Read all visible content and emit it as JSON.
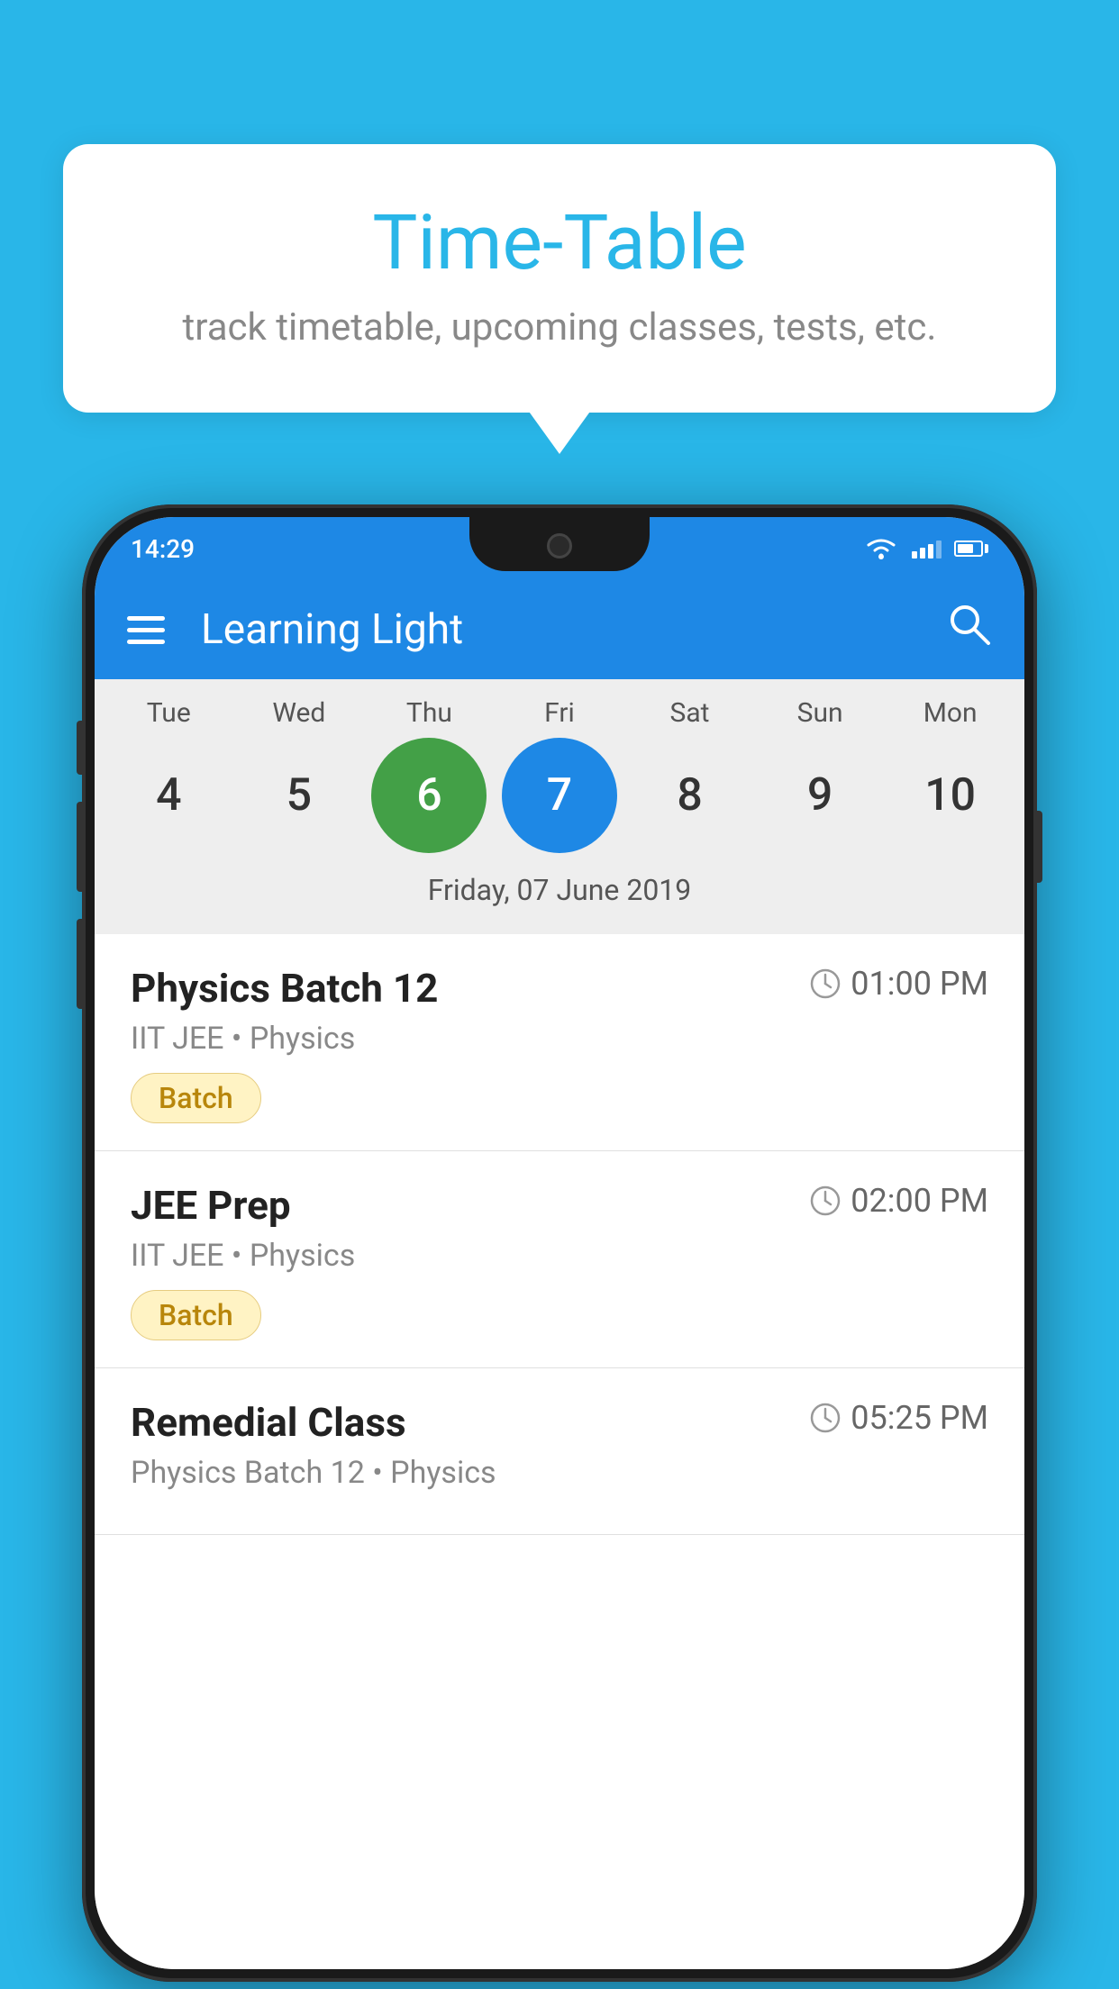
{
  "background_color": "#29b6e8",
  "tooltip": {
    "title": "Time-Table",
    "subtitle": "track timetable, upcoming classes, tests, etc."
  },
  "app": {
    "name": "Learning Light",
    "status_time": "14:29"
  },
  "calendar": {
    "days": [
      {
        "label": "Tue",
        "num": "4"
      },
      {
        "label": "Wed",
        "num": "5"
      },
      {
        "label": "Thu",
        "num": "6",
        "state": "today"
      },
      {
        "label": "Fri",
        "num": "7",
        "state": "selected"
      },
      {
        "label": "Sat",
        "num": "8"
      },
      {
        "label": "Sun",
        "num": "9"
      },
      {
        "label": "Mon",
        "num": "10"
      }
    ],
    "selected_date": "Friday, 07 June 2019"
  },
  "schedule": [
    {
      "name": "Physics Batch 12",
      "time": "01:00 PM",
      "meta": "IIT JEE • Physics",
      "tag": "Batch"
    },
    {
      "name": "JEE Prep",
      "time": "02:00 PM",
      "meta": "IIT JEE • Physics",
      "tag": "Batch"
    },
    {
      "name": "Remedial Class",
      "time": "05:25 PM",
      "meta": "Physics Batch 12 • Physics",
      "tag": null
    }
  ],
  "icons": {
    "menu": "☰",
    "search": "🔍",
    "clock": "🕐"
  }
}
